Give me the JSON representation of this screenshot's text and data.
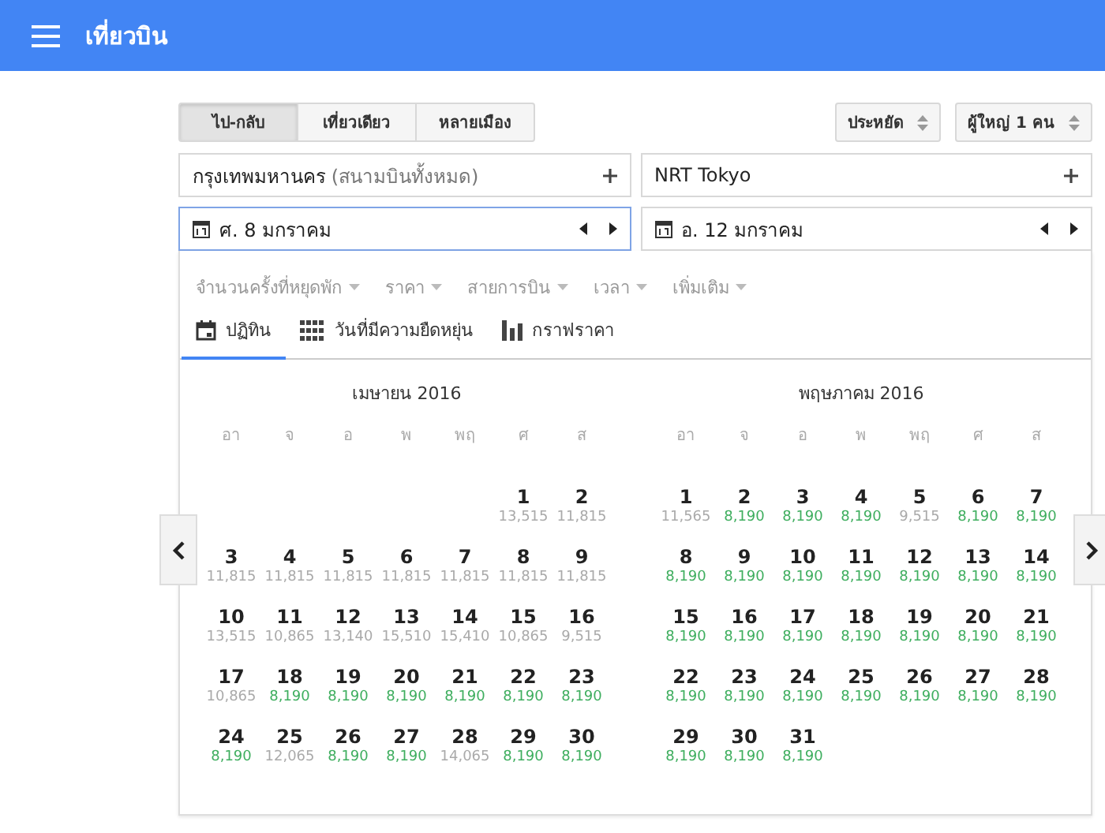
{
  "app_bar": {
    "title": "เที่ยวบิน"
  },
  "trip_types": [
    {
      "label": "ไป-กลับ",
      "selected": true
    },
    {
      "label": "เที่ยวเดียว",
      "selected": false
    },
    {
      "label": "หลายเมือง",
      "selected": false
    }
  ],
  "selects": [
    {
      "value": "ประหยัด"
    },
    {
      "value": "ผู้ใหญ่ 1 คน"
    }
  ],
  "places": [
    {
      "value": "กรุงเทพมหานคร",
      "detail": " (สนามบินทั้งหมด)",
      "focused": false
    },
    {
      "value": "NRT Tokyo",
      "focused": false
    }
  ],
  "dates": [
    {
      "value": "ศ. 8 มกราคม",
      "focused": true
    },
    {
      "value": "อ. 12 มกราคม",
      "focused": false
    }
  ],
  "filters": [
    "จำนวนครั้งที่หยุดพัก",
    "ราคา",
    "สายการบิน",
    "เวลา",
    "เพิ่มเติม"
  ],
  "view_tabs": [
    {
      "label": "ปฏิทิน",
      "kind": "calendar",
      "selected": true
    },
    {
      "label": "วันที่มีความยืดหยุ่น",
      "kind": "grid",
      "selected": false
    },
    {
      "label": "กราฟราคา",
      "kind": "chart",
      "selected": false
    }
  ],
  "months": [
    {
      "title": "เมษายน 2016",
      "weekdays": [
        "อา",
        "จ",
        "อ",
        "พ",
        "พฤ",
        "ศ",
        "ส"
      ],
      "days": [
        {
          "kind": "blank"
        },
        {
          "kind": "blank"
        },
        {
          "kind": "blank"
        },
        {
          "kind": "blank"
        },
        {
          "kind": "blank"
        },
        {
          "kind": "day",
          "day": "1",
          "price": "13,515",
          "cheap": false
        },
        {
          "kind": "day",
          "day": "2",
          "price": "11,815",
          "cheap": false
        },
        {
          "kind": "day",
          "day": "3",
          "price": "11,815",
          "cheap": false
        },
        {
          "kind": "day",
          "day": "4",
          "price": "11,815",
          "cheap": false
        },
        {
          "kind": "day",
          "day": "5",
          "price": "11,815",
          "cheap": false
        },
        {
          "kind": "day",
          "day": "6",
          "price": "11,815",
          "cheap": false
        },
        {
          "kind": "day",
          "day": "7",
          "price": "11,815",
          "cheap": false
        },
        {
          "kind": "day",
          "day": "8",
          "price": "11,815",
          "cheap": false
        },
        {
          "kind": "day",
          "day": "9",
          "price": "11,815",
          "cheap": false
        },
        {
          "kind": "day",
          "day": "10",
          "price": "13,515",
          "cheap": false
        },
        {
          "kind": "day",
          "day": "11",
          "price": "10,865",
          "cheap": false
        },
        {
          "kind": "day",
          "day": "12",
          "price": "13,140",
          "cheap": false
        },
        {
          "kind": "day",
          "day": "13",
          "price": "15,510",
          "cheap": false
        },
        {
          "kind": "day",
          "day": "14",
          "price": "15,410",
          "cheap": false
        },
        {
          "kind": "day",
          "day": "15",
          "price": "10,865",
          "cheap": false
        },
        {
          "kind": "day",
          "day": "16",
          "price": "9,515",
          "cheap": false
        },
        {
          "kind": "day",
          "day": "17",
          "price": "10,865",
          "cheap": false
        },
        {
          "kind": "day",
          "day": "18",
          "price": "8,190",
          "cheap": true
        },
        {
          "kind": "day",
          "day": "19",
          "price": "8,190",
          "cheap": true
        },
        {
          "kind": "day",
          "day": "20",
          "price": "8,190",
          "cheap": true
        },
        {
          "kind": "day",
          "day": "21",
          "price": "8,190",
          "cheap": true
        },
        {
          "kind": "day",
          "day": "22",
          "price": "8,190",
          "cheap": true
        },
        {
          "kind": "day",
          "day": "23",
          "price": "8,190",
          "cheap": true
        },
        {
          "kind": "day",
          "day": "24",
          "price": "8,190",
          "cheap": true
        },
        {
          "kind": "day",
          "day": "25",
          "price": "12,065",
          "cheap": false
        },
        {
          "kind": "day",
          "day": "26",
          "price": "8,190",
          "cheap": true
        },
        {
          "kind": "day",
          "day": "27",
          "price": "8,190",
          "cheap": true
        },
        {
          "kind": "day",
          "day": "28",
          "price": "14,065",
          "cheap": false
        },
        {
          "kind": "day",
          "day": "29",
          "price": "8,190",
          "cheap": true
        },
        {
          "kind": "day",
          "day": "30",
          "price": "8,190",
          "cheap": true
        }
      ]
    },
    {
      "title": "พฤษภาคม 2016",
      "weekdays": [
        "อา",
        "จ",
        "อ",
        "พ",
        "พฤ",
        "ศ",
        "ส"
      ],
      "days": [
        {
          "kind": "day",
          "day": "1",
          "price": "11,565",
          "cheap": false
        },
        {
          "kind": "day",
          "day": "2",
          "price": "8,190",
          "cheap": true
        },
        {
          "kind": "day",
          "day": "3",
          "price": "8,190",
          "cheap": true
        },
        {
          "kind": "day",
          "day": "4",
          "price": "8,190",
          "cheap": true
        },
        {
          "kind": "day",
          "day": "5",
          "price": "9,515",
          "cheap": false
        },
        {
          "kind": "day",
          "day": "6",
          "price": "8,190",
          "cheap": true
        },
        {
          "kind": "day",
          "day": "7",
          "price": "8,190",
          "cheap": true
        },
        {
          "kind": "day",
          "day": "8",
          "price": "8,190",
          "cheap": true
        },
        {
          "kind": "day",
          "day": "9",
          "price": "8,190",
          "cheap": true
        },
        {
          "kind": "day",
          "day": "10",
          "price": "8,190",
          "cheap": true
        },
        {
          "kind": "day",
          "day": "11",
          "price": "8,190",
          "cheap": true
        },
        {
          "kind": "day",
          "day": "12",
          "price": "8,190",
          "cheap": true
        },
        {
          "kind": "day",
          "day": "13",
          "price": "8,190",
          "cheap": true
        },
        {
          "kind": "day",
          "day": "14",
          "price": "8,190",
          "cheap": true
        },
        {
          "kind": "day",
          "day": "15",
          "price": "8,190",
          "cheap": true
        },
        {
          "kind": "day",
          "day": "16",
          "price": "8,190",
          "cheap": true
        },
        {
          "kind": "day",
          "day": "17",
          "price": "8,190",
          "cheap": true
        },
        {
          "kind": "day",
          "day": "18",
          "price": "8,190",
          "cheap": true
        },
        {
          "kind": "day",
          "day": "19",
          "price": "8,190",
          "cheap": true
        },
        {
          "kind": "day",
          "day": "20",
          "price": "8,190",
          "cheap": true
        },
        {
          "kind": "day",
          "day": "21",
          "price": "8,190",
          "cheap": true
        },
        {
          "kind": "day",
          "day": "22",
          "price": "8,190",
          "cheap": true
        },
        {
          "kind": "day",
          "day": "23",
          "price": "8,190",
          "cheap": true
        },
        {
          "kind": "day",
          "day": "24",
          "price": "8,190",
          "cheap": true
        },
        {
          "kind": "day",
          "day": "25",
          "price": "8,190",
          "cheap": true
        },
        {
          "kind": "day",
          "day": "26",
          "price": "8,190",
          "cheap": true
        },
        {
          "kind": "day",
          "day": "27",
          "price": "8,190",
          "cheap": true
        },
        {
          "kind": "day",
          "day": "28",
          "price": "8,190",
          "cheap": true
        },
        {
          "kind": "day",
          "day": "29",
          "price": "8,190",
          "cheap": true
        },
        {
          "kind": "day",
          "day": "30",
          "price": "8,190",
          "cheap": true
        },
        {
          "kind": "day",
          "day": "31",
          "price": "8,190",
          "cheap": true
        }
      ]
    }
  ]
}
